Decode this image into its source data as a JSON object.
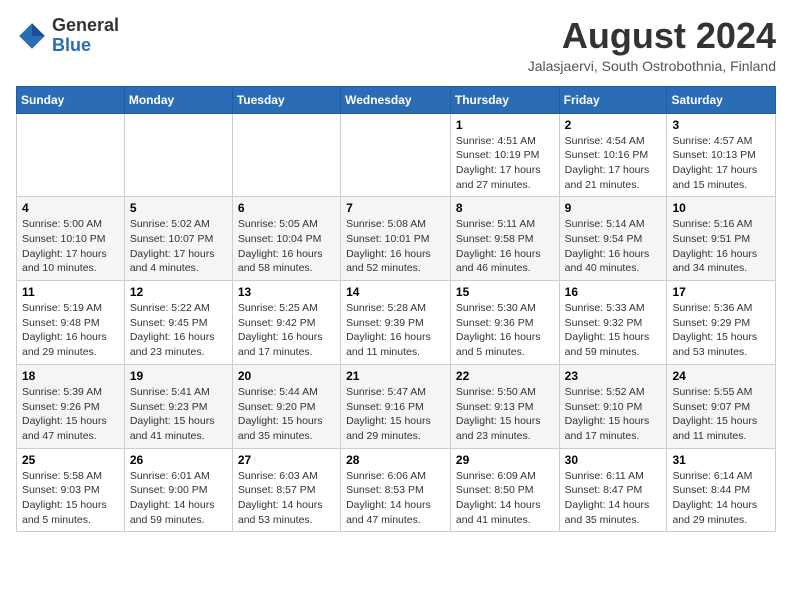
{
  "header": {
    "logo_general": "General",
    "logo_blue": "Blue",
    "month_title": "August 2024",
    "subtitle": "Jalasjaervi, South Ostrobothnia, Finland"
  },
  "columns": [
    "Sunday",
    "Monday",
    "Tuesday",
    "Wednesday",
    "Thursday",
    "Friday",
    "Saturday"
  ],
  "weeks": [
    [
      {
        "day": "",
        "info": ""
      },
      {
        "day": "",
        "info": ""
      },
      {
        "day": "",
        "info": ""
      },
      {
        "day": "",
        "info": ""
      },
      {
        "day": "1",
        "info": "Sunrise: 4:51 AM\nSunset: 10:19 PM\nDaylight: 17 hours\nand 27 minutes."
      },
      {
        "day": "2",
        "info": "Sunrise: 4:54 AM\nSunset: 10:16 PM\nDaylight: 17 hours\nand 21 minutes."
      },
      {
        "day": "3",
        "info": "Sunrise: 4:57 AM\nSunset: 10:13 PM\nDaylight: 17 hours\nand 15 minutes."
      }
    ],
    [
      {
        "day": "4",
        "info": "Sunrise: 5:00 AM\nSunset: 10:10 PM\nDaylight: 17 hours\nand 10 minutes."
      },
      {
        "day": "5",
        "info": "Sunrise: 5:02 AM\nSunset: 10:07 PM\nDaylight: 17 hours\nand 4 minutes."
      },
      {
        "day": "6",
        "info": "Sunrise: 5:05 AM\nSunset: 10:04 PM\nDaylight: 16 hours\nand 58 minutes."
      },
      {
        "day": "7",
        "info": "Sunrise: 5:08 AM\nSunset: 10:01 PM\nDaylight: 16 hours\nand 52 minutes."
      },
      {
        "day": "8",
        "info": "Sunrise: 5:11 AM\nSunset: 9:58 PM\nDaylight: 16 hours\nand 46 minutes."
      },
      {
        "day": "9",
        "info": "Sunrise: 5:14 AM\nSunset: 9:54 PM\nDaylight: 16 hours\nand 40 minutes."
      },
      {
        "day": "10",
        "info": "Sunrise: 5:16 AM\nSunset: 9:51 PM\nDaylight: 16 hours\nand 34 minutes."
      }
    ],
    [
      {
        "day": "11",
        "info": "Sunrise: 5:19 AM\nSunset: 9:48 PM\nDaylight: 16 hours\nand 29 minutes."
      },
      {
        "day": "12",
        "info": "Sunrise: 5:22 AM\nSunset: 9:45 PM\nDaylight: 16 hours\nand 23 minutes."
      },
      {
        "day": "13",
        "info": "Sunrise: 5:25 AM\nSunset: 9:42 PM\nDaylight: 16 hours\nand 17 minutes."
      },
      {
        "day": "14",
        "info": "Sunrise: 5:28 AM\nSunset: 9:39 PM\nDaylight: 16 hours\nand 11 minutes."
      },
      {
        "day": "15",
        "info": "Sunrise: 5:30 AM\nSunset: 9:36 PM\nDaylight: 16 hours\nand 5 minutes."
      },
      {
        "day": "16",
        "info": "Sunrise: 5:33 AM\nSunset: 9:32 PM\nDaylight: 15 hours\nand 59 minutes."
      },
      {
        "day": "17",
        "info": "Sunrise: 5:36 AM\nSunset: 9:29 PM\nDaylight: 15 hours\nand 53 minutes."
      }
    ],
    [
      {
        "day": "18",
        "info": "Sunrise: 5:39 AM\nSunset: 9:26 PM\nDaylight: 15 hours\nand 47 minutes."
      },
      {
        "day": "19",
        "info": "Sunrise: 5:41 AM\nSunset: 9:23 PM\nDaylight: 15 hours\nand 41 minutes."
      },
      {
        "day": "20",
        "info": "Sunrise: 5:44 AM\nSunset: 9:20 PM\nDaylight: 15 hours\nand 35 minutes."
      },
      {
        "day": "21",
        "info": "Sunrise: 5:47 AM\nSunset: 9:16 PM\nDaylight: 15 hours\nand 29 minutes."
      },
      {
        "day": "22",
        "info": "Sunrise: 5:50 AM\nSunset: 9:13 PM\nDaylight: 15 hours\nand 23 minutes."
      },
      {
        "day": "23",
        "info": "Sunrise: 5:52 AM\nSunset: 9:10 PM\nDaylight: 15 hours\nand 17 minutes."
      },
      {
        "day": "24",
        "info": "Sunrise: 5:55 AM\nSunset: 9:07 PM\nDaylight: 15 hours\nand 11 minutes."
      }
    ],
    [
      {
        "day": "25",
        "info": "Sunrise: 5:58 AM\nSunset: 9:03 PM\nDaylight: 15 hours\nand 5 minutes."
      },
      {
        "day": "26",
        "info": "Sunrise: 6:01 AM\nSunset: 9:00 PM\nDaylight: 14 hours\nand 59 minutes."
      },
      {
        "day": "27",
        "info": "Sunrise: 6:03 AM\nSunset: 8:57 PM\nDaylight: 14 hours\nand 53 minutes."
      },
      {
        "day": "28",
        "info": "Sunrise: 6:06 AM\nSunset: 8:53 PM\nDaylight: 14 hours\nand 47 minutes."
      },
      {
        "day": "29",
        "info": "Sunrise: 6:09 AM\nSunset: 8:50 PM\nDaylight: 14 hours\nand 41 minutes."
      },
      {
        "day": "30",
        "info": "Sunrise: 6:11 AM\nSunset: 8:47 PM\nDaylight: 14 hours\nand 35 minutes."
      },
      {
        "day": "31",
        "info": "Sunrise: 6:14 AM\nSunset: 8:44 PM\nDaylight: 14 hours\nand 29 minutes."
      }
    ]
  ]
}
